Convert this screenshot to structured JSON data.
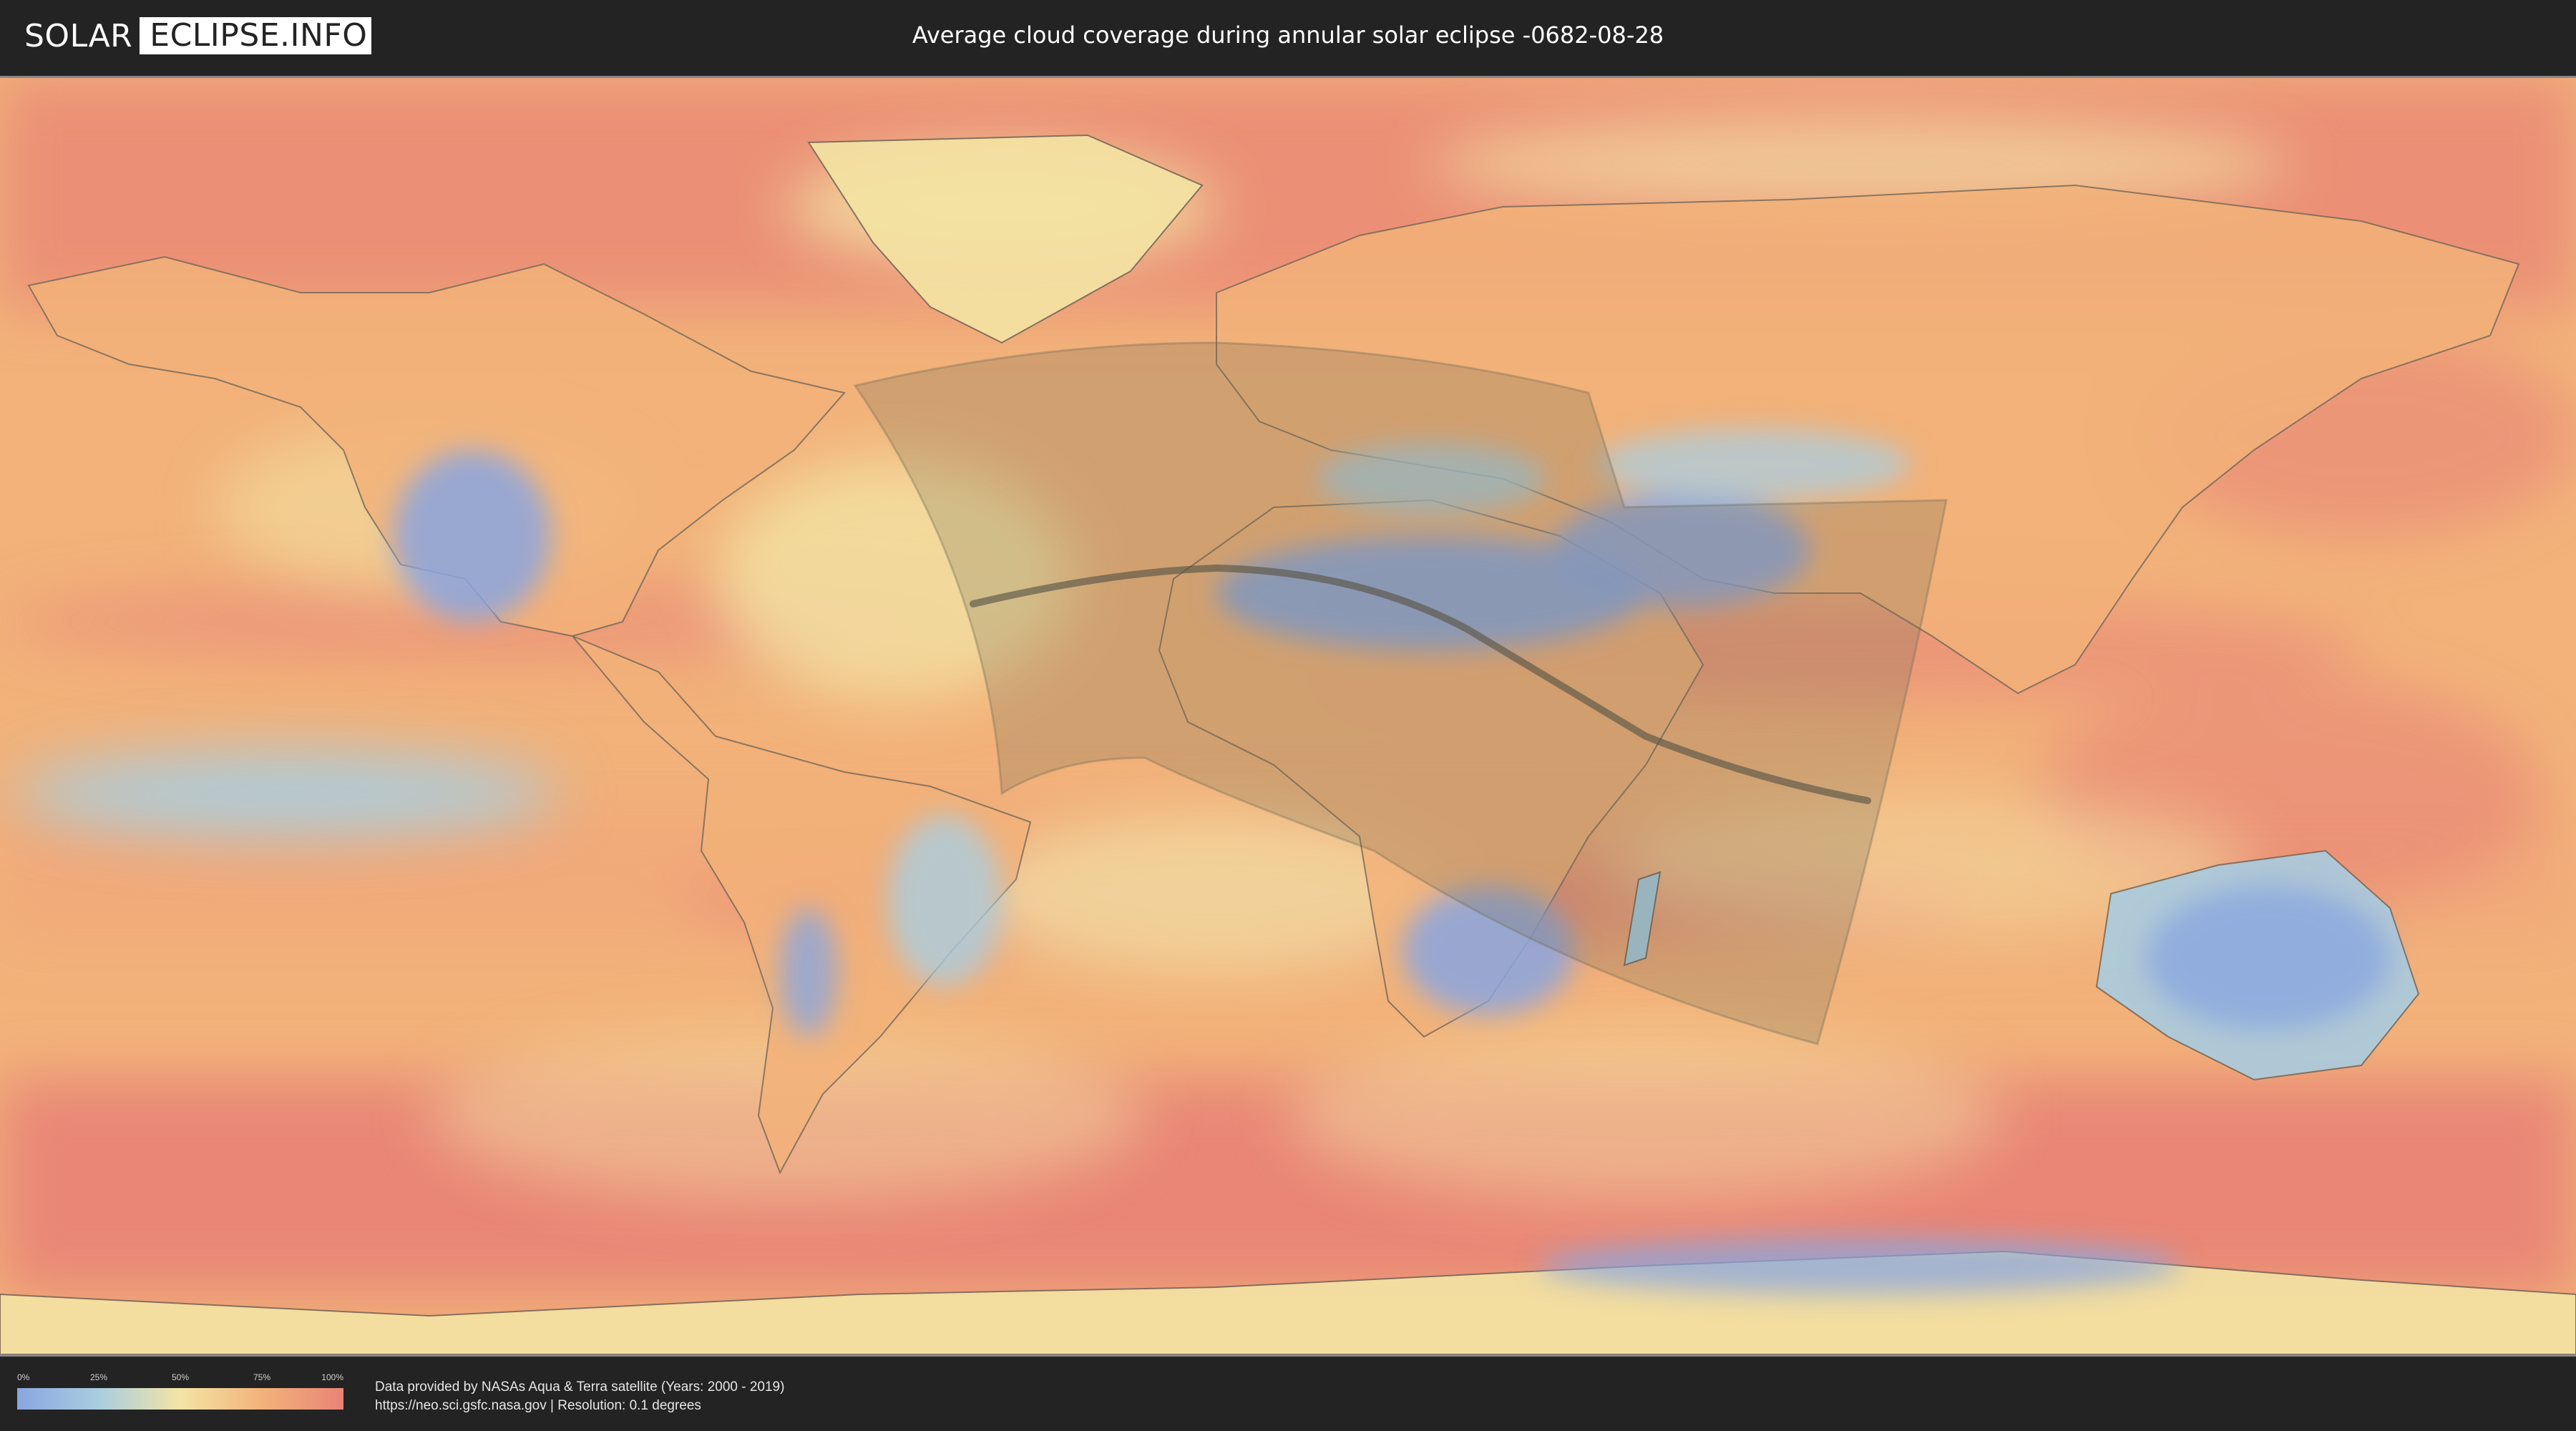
{
  "header": {
    "logo_left": "SOLAR",
    "logo_right": "ECLIPSE.INFO",
    "title": "Average cloud coverage during annular solar eclipse -0682-08-28"
  },
  "map": {
    "projection": "equirectangular",
    "layer": "average cloud coverage",
    "eclipse_path": "annular",
    "colors": {
      "clear": "#8aa6df",
      "low": "#a9cde0",
      "medium": "#f3e4a4",
      "high": "#f2b27a",
      "overcast": "#e88476",
      "shadow_overlay": "#6e6a55",
      "central_line": "#5b5647"
    }
  },
  "legend": {
    "ticks": [
      "0%",
      "25%",
      "50%",
      "75%",
      "100%"
    ]
  },
  "footer": {
    "line1": "Data provided by NASAs Aqua & Terra satellite (Years: 2000 - 2019)",
    "line2": "https://neo.sci.gsfc.nasa.gov | Resolution: 0.1 degrees"
  }
}
